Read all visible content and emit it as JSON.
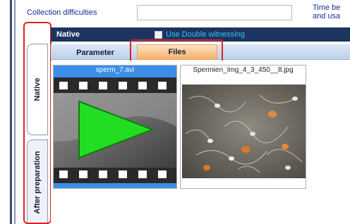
{
  "header": {
    "collection_label": "Collection difficulties",
    "collection_value": "",
    "right_text": "Time be\nand usa"
  },
  "side_tabs": [
    {
      "label": "Native"
    },
    {
      "label": "After preparation"
    }
  ],
  "section": {
    "title": "Native",
    "double_witnessing_label": "Use Double witnessing",
    "double_witnessing_checked": false
  },
  "subtabs": [
    {
      "label": "Parameter",
      "active": false
    },
    {
      "label": "Files",
      "active": true
    }
  ],
  "files": [
    {
      "name": "sperm_7.avi",
      "type": "video-icon",
      "selected": true
    },
    {
      "name": "Spermien_Img_4_3_450__8.jpg",
      "type": "image-thumbnail",
      "selected": false
    }
  ],
  "colors": {
    "annotation_red": "#e02020",
    "section_bar": "#1c3560",
    "checkbox_label": "#31c5ee",
    "selected_blue": "#3c8fe8",
    "active_tab_orange": "#f7b06c",
    "play_green": "#22dd22"
  }
}
